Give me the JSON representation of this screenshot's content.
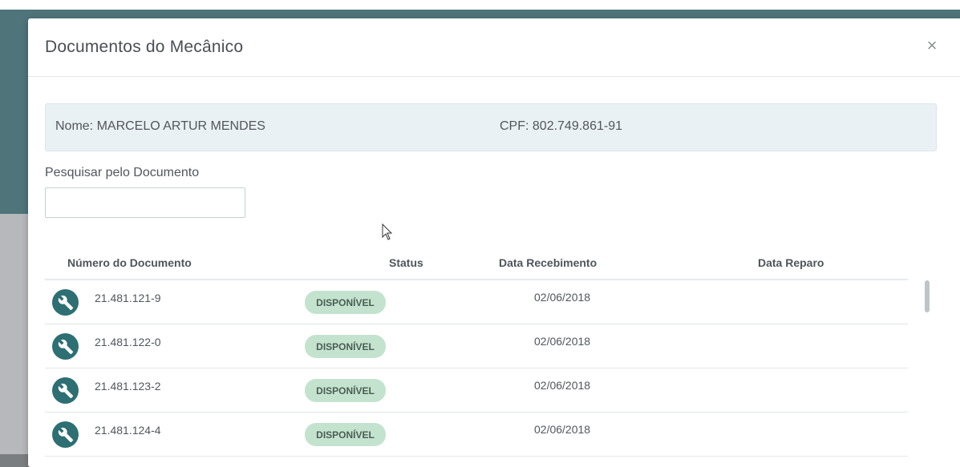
{
  "modal": {
    "title": "Documentos do Mecânico",
    "close_label": "×"
  },
  "info": {
    "name": "Nome: MARCELO ARTUR MENDES",
    "cpf": "CPF: 802.749.861-91"
  },
  "search": {
    "label": "Pesquisar pelo Documento",
    "value": "",
    "placeholder": ""
  },
  "table": {
    "headers": {
      "document": "Número do Documento",
      "status": "Status",
      "received": "Data Recebimento",
      "repair": "Data Reparo"
    },
    "rows": [
      {
        "icon": "wrench-icon",
        "document": "21.481.121-9",
        "status": "DISPONÍVEL",
        "received": "02/06/2018",
        "repair": ""
      },
      {
        "icon": "wrench-icon",
        "document": "21.481.122-0",
        "status": "DISPONÍVEL",
        "received": "02/06/2018",
        "repair": ""
      },
      {
        "icon": "wrench-icon",
        "document": "21.481.123-2",
        "status": "DISPONÍVEL",
        "received": "02/06/2018",
        "repair": ""
      },
      {
        "icon": "wrench-icon",
        "document": "21.481.124-4",
        "status": "DISPONÍVEL",
        "received": "02/06/2018",
        "repair": ""
      }
    ]
  },
  "colors": {
    "accent": "#2d6f73",
    "badge_bg": "#c4e3cf",
    "info_bg": "#eaf1f5"
  }
}
